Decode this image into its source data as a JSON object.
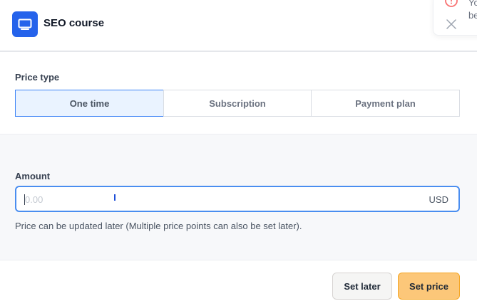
{
  "header": {
    "title": "SEO course",
    "icon": "monitor-icon",
    "accent_color": "#2563eb"
  },
  "toast": {
    "icon": "alert-circle-icon",
    "text": "Yo\nbe",
    "close_icon": "close-icon",
    "icon_color": "#f87171"
  },
  "price_type": {
    "label": "Price type",
    "options": [
      {
        "label": "One time",
        "selected": true
      },
      {
        "label": "Subscription",
        "selected": false
      },
      {
        "label": "Payment plan",
        "selected": false
      }
    ]
  },
  "amount": {
    "label": "Amount",
    "value": "",
    "placeholder": "0.00",
    "currency": "USD",
    "helper": "Price can be updated later (Multiple price points can also be set later)."
  },
  "footer": {
    "set_later_label": "Set later",
    "set_price_label": "Set price",
    "primary_color": "#fcc779"
  }
}
